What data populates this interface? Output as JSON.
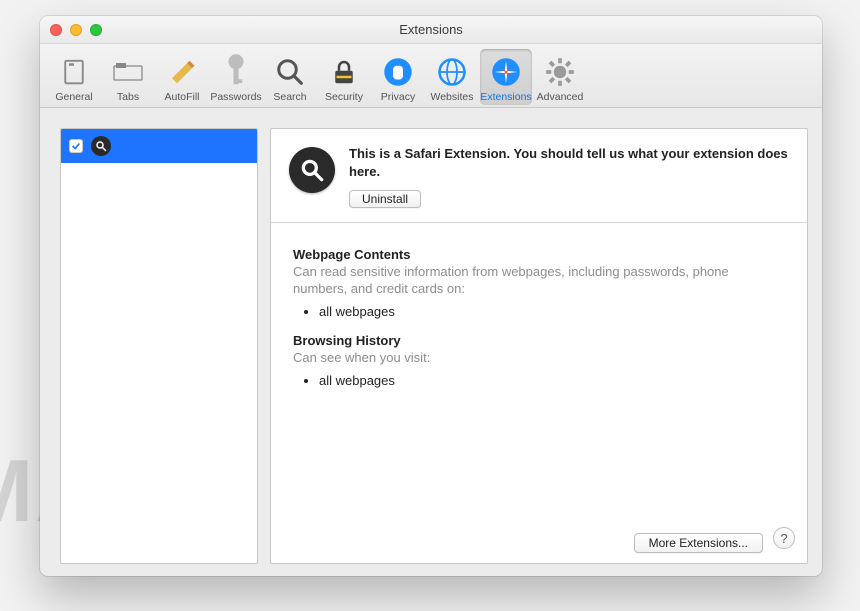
{
  "window": {
    "title": "Extensions"
  },
  "toolbar": {
    "items": [
      {
        "label": "General",
        "icon": "general-icon",
        "selected": false
      },
      {
        "label": "Tabs",
        "icon": "tabs-icon",
        "selected": false
      },
      {
        "label": "AutoFill",
        "icon": "autofill-icon",
        "selected": false
      },
      {
        "label": "Passwords",
        "icon": "passwords-icon",
        "selected": false
      },
      {
        "label": "Search",
        "icon": "search-icon",
        "selected": false
      },
      {
        "label": "Security",
        "icon": "security-icon",
        "selected": false
      },
      {
        "label": "Privacy",
        "icon": "privacy-icon",
        "selected": false
      },
      {
        "label": "Websites",
        "icon": "websites-icon",
        "selected": false
      },
      {
        "label": "Extensions",
        "icon": "extensions-icon",
        "selected": true
      },
      {
        "label": "Advanced",
        "icon": "advanced-icon",
        "selected": false
      }
    ]
  },
  "sidebar": {
    "items": [
      {
        "enabled": true,
        "icon": "magnifier-icon"
      }
    ]
  },
  "detail": {
    "description": "This is a Safari Extension. You should tell us what your extension does here.",
    "uninstall_label": "Uninstall",
    "permissions": [
      {
        "heading": "Webpage Contents",
        "description": "Can read sensitive information from webpages, including passwords, phone numbers, and credit cards on:",
        "bullets": [
          "all webpages"
        ]
      },
      {
        "heading": "Browsing History",
        "description": "Can see when you visit:",
        "bullets": [
          "all webpages"
        ]
      }
    ]
  },
  "footer": {
    "more_label": "More Extensions...",
    "help_label": "?"
  },
  "watermark": "MALWARETIPS"
}
